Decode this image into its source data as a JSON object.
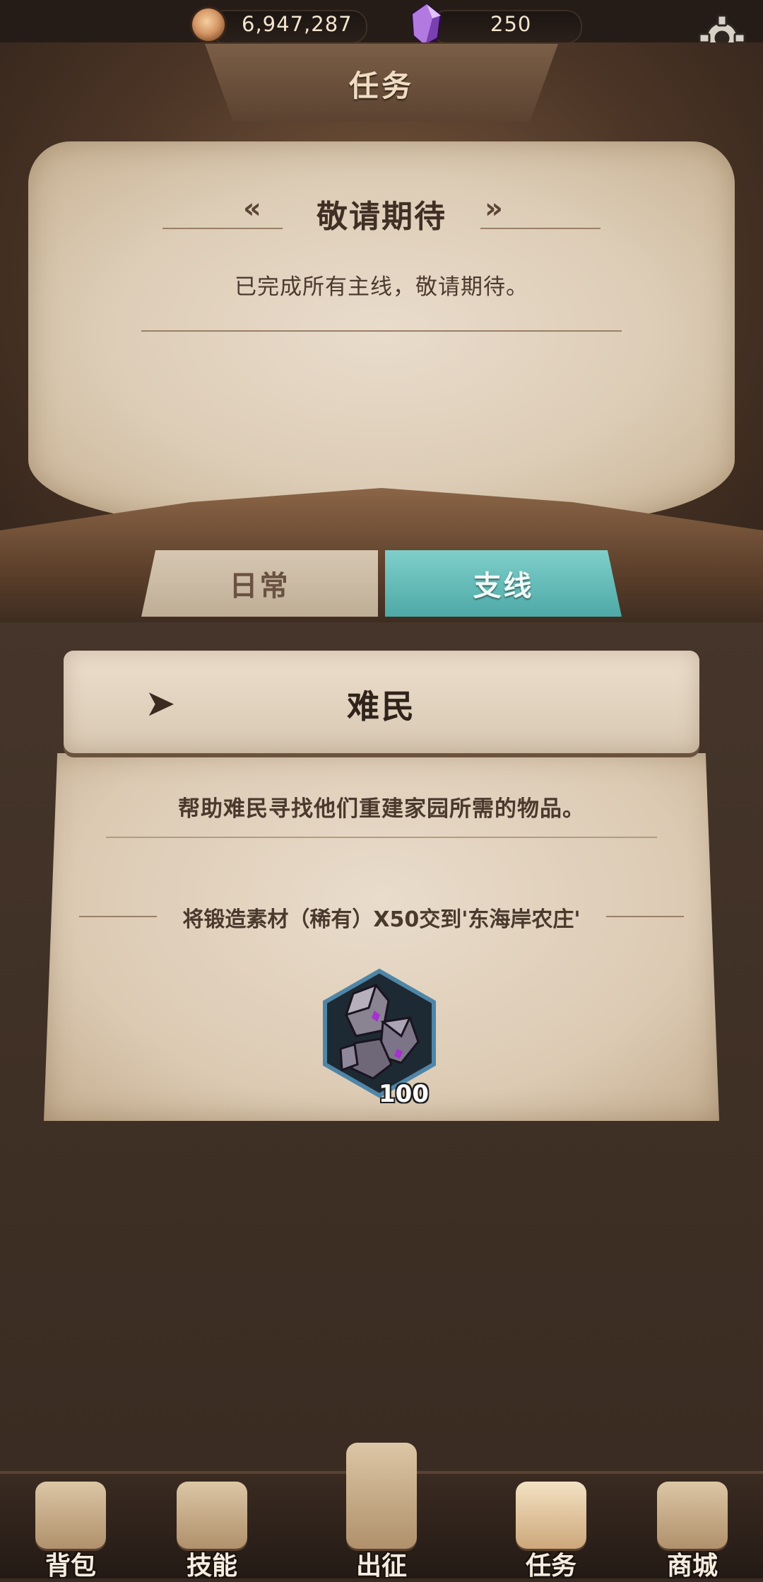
{
  "resources": {
    "coins": "6,947,287",
    "gems": "250"
  },
  "header": {
    "title": "任务"
  },
  "notice": {
    "title": "敬请期待",
    "body": "已完成所有主线，敬请期待。"
  },
  "tabs": [
    {
      "label": "日常",
      "active": false
    },
    {
      "label": "支线",
      "active": true
    }
  ],
  "quest": {
    "name": "难民",
    "description": "帮助难民寻找他们重建家园所需的物品。",
    "objective": "将锻造素材（稀有）X50交到'东海岸农庄'",
    "reward": {
      "icon": "rare-forge-material-icon",
      "count": "100"
    }
  },
  "nav": [
    {
      "label": "背包",
      "icon": "backpack-icon"
    },
    {
      "label": "技能",
      "icon": "skill-book-icon"
    },
    {
      "label": "出征",
      "icon": "sword-map-icon"
    },
    {
      "label": "任务",
      "icon": "horn-scroll-icon"
    },
    {
      "label": "商城",
      "icon": "shop-crown-icon"
    }
  ],
  "colors": {
    "active_tab": "#5fbab6",
    "parchment": "#e6d8c5",
    "wood": "#5b4331"
  }
}
